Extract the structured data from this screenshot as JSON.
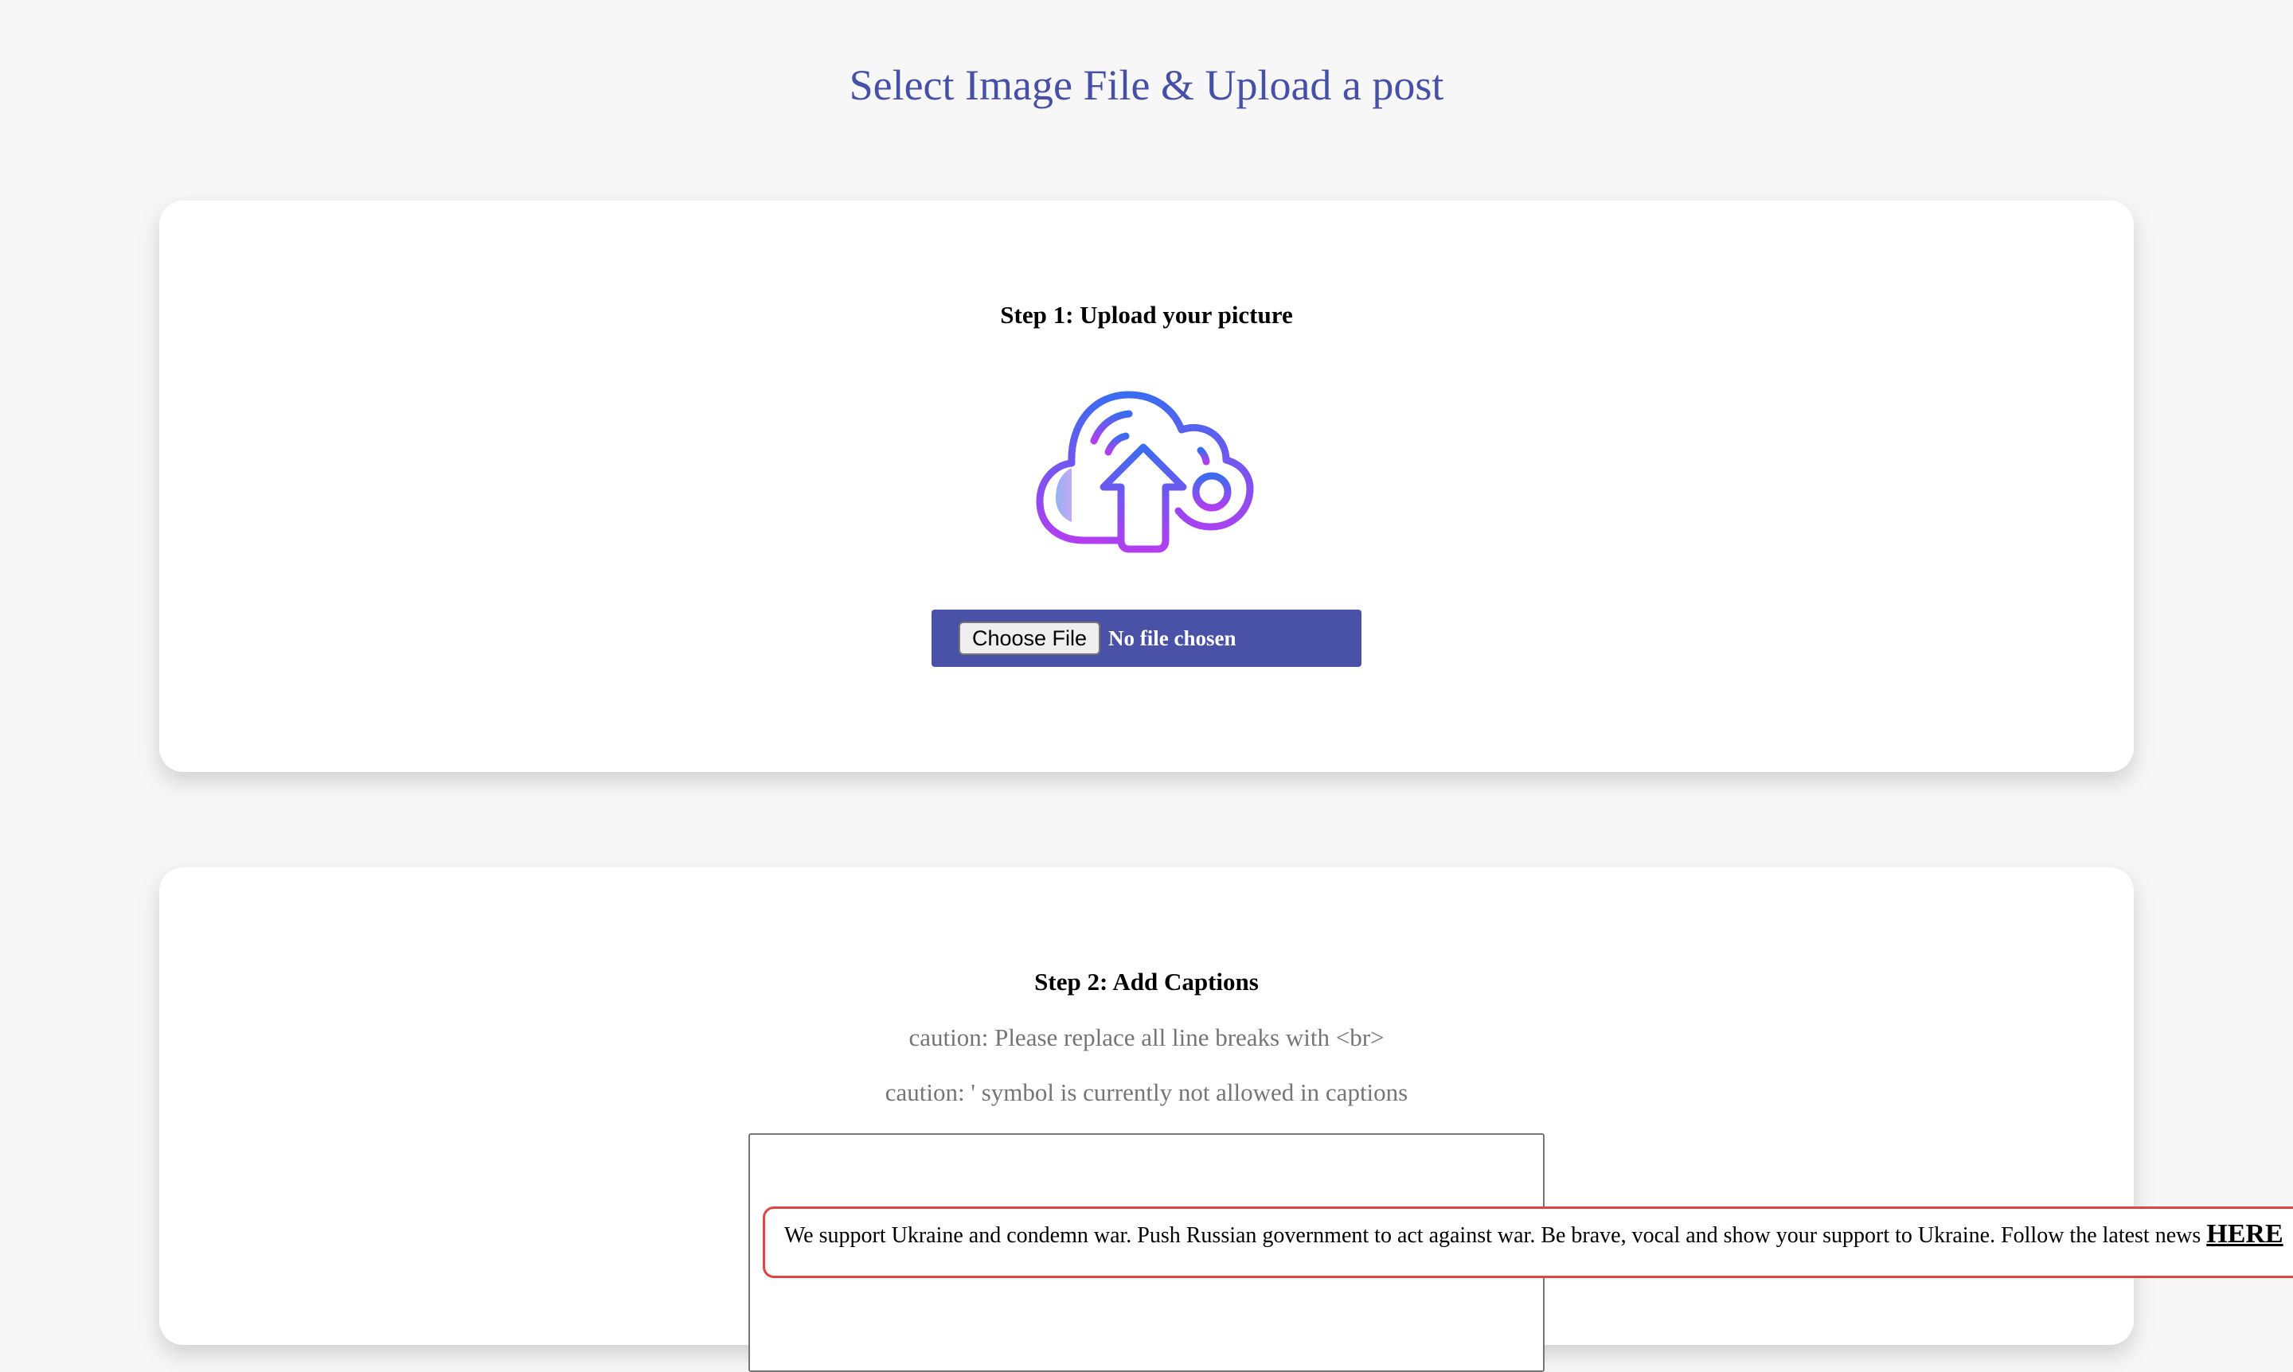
{
  "page": {
    "title": "Select Image File & Upload a post"
  },
  "step1": {
    "title": "Step 1: Upload your picture",
    "icon": "cloud-upload-icon",
    "file_input": {
      "button_label": "Choose File",
      "status_text": "No file chosen"
    }
  },
  "step2": {
    "title": "Step 2: Add Captions",
    "caution_1": "caution: Please replace all line breaks with <br>",
    "caution_2": "caution: ' symbol is currently not allowed in captions",
    "caption_value": ""
  },
  "banner": {
    "text": "We support Ukraine and condemn war. Push Russian government to act against war. Be brave, vocal and show your support to Ukraine. Follow the latest news",
    "link_label": "HERE"
  },
  "colors": {
    "title": "#4650a7",
    "file_box": "#4a52a8",
    "icon_gradient_start": "#3b6cf0",
    "icon_gradient_end": "#b23ef0",
    "banner_border": "#e04545",
    "caution_text": "#757575"
  }
}
